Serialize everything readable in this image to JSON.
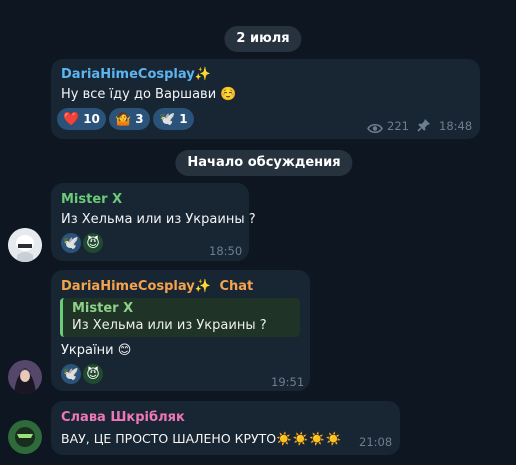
{
  "colors": {
    "background": "#0e1621",
    "bubble": "#182533",
    "reaction_bg": "#2b5278",
    "time": "#6d7f8f",
    "name_blue": "#5db5f0",
    "name_green": "#6bcb77",
    "name_orange": "#f5a34d",
    "name_pink": "#ee77b6"
  },
  "date_separator": "2 июля",
  "discussion_separator": "Начало обсуждения",
  "post": {
    "sender": "DariaHimeCosplay",
    "sender_emoji": "✨",
    "text": "Ну все їду до Варшави",
    "text_emoji": "☺️",
    "reactions": [
      {
        "emoji": "❤️",
        "count": "10",
        "icon": "heart-icon"
      },
      {
        "emoji": "🤷",
        "count": "3",
        "icon": "shrug-icon"
      },
      {
        "emoji": "🕊️",
        "count": "1",
        "icon": "dove-icon"
      }
    ],
    "views": "221",
    "time": "18:48",
    "views_icon": "eye-icon",
    "pin_icon": "pin-icon"
  },
  "messages": [
    {
      "sender": "Mister X",
      "text": "Из Хельма или из Украины ?",
      "reactions": [
        "🕊️",
        "😈"
      ],
      "time": "18:50"
    },
    {
      "sender": "DariaHimeCosplay",
      "sender_emoji": "✨",
      "badge": "Chat",
      "reply": {
        "sender": "Mister X",
        "text": "Из Хельма или из Украины ?"
      },
      "text": "України",
      "text_emoji": "😊",
      "reactions": [
        "🕊️",
        "😈"
      ],
      "time": "19:51"
    },
    {
      "sender": "Слава Шкрібляк",
      "text": "ВАУ, ЦЕ ПРОСТО ШАЛЕНО КРУТО",
      "text_emoji": "☀️☀️☀️☀️",
      "time": "21:08"
    }
  ]
}
